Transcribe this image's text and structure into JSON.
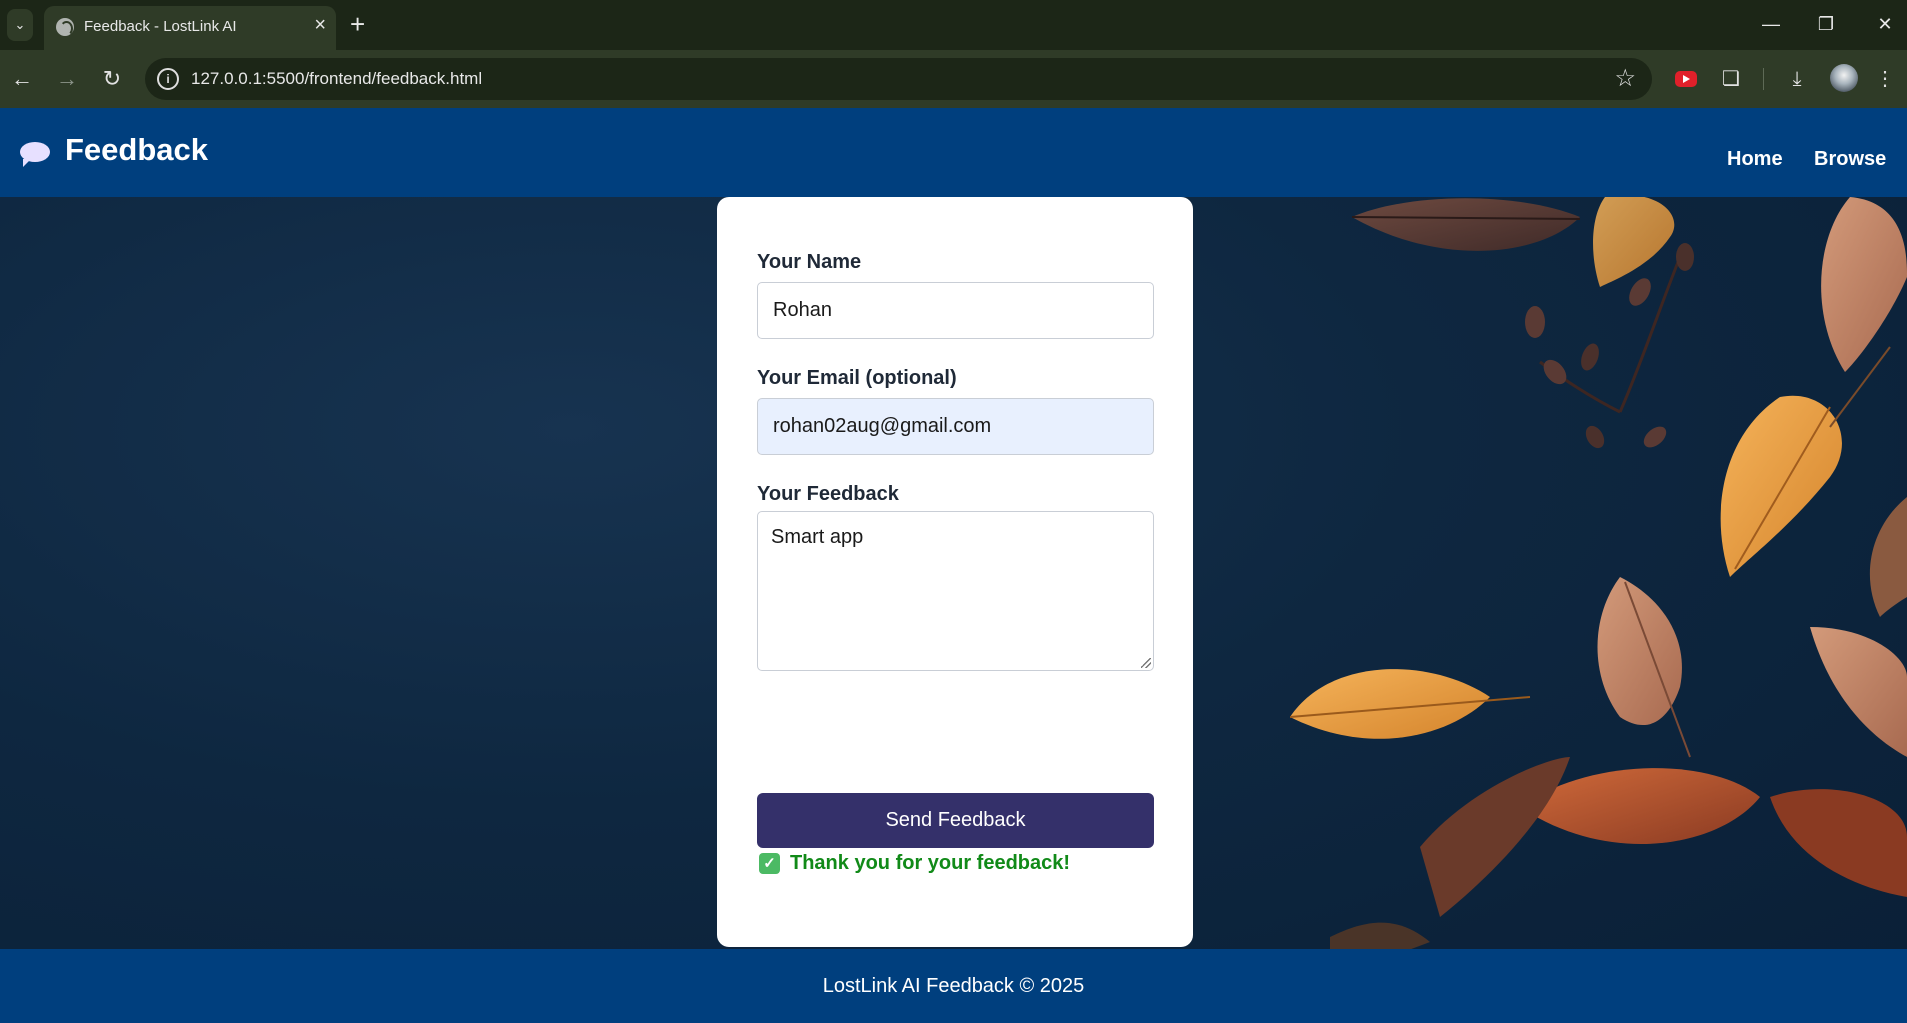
{
  "browser": {
    "tab_title": "Feedback - LostLink AI",
    "url": "127.0.0.1:5500/frontend/feedback.html"
  },
  "header": {
    "title": "Feedback",
    "nav": [
      {
        "label": "Home"
      },
      {
        "label": "Browse"
      }
    ]
  },
  "form": {
    "name_label": "Your Name",
    "name_value": "Rohan",
    "email_label": "Your Email (optional)",
    "email_value": "rohan02aug@gmail.com",
    "feedback_label": "Your Feedback",
    "feedback_value": "Smart app",
    "submit_label": "Send Feedback",
    "success_message": "Thank you for your feedback!"
  },
  "footer": {
    "text": "LostLink AI Feedback © 2025"
  },
  "colors": {
    "header_bg": "#003f7e",
    "button_bg": "#34306a",
    "success_text": "#118a18"
  }
}
